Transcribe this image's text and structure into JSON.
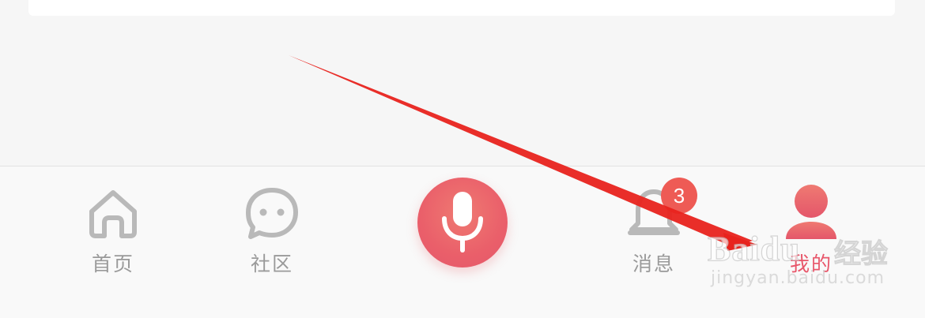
{
  "tabbar": {
    "tabs": [
      {
        "label": "首页",
        "icon": "home-icon"
      },
      {
        "label": "社区",
        "icon": "chat-bubble-icon"
      },
      {
        "label": "消息",
        "icon": "bell-icon",
        "badge": "3"
      },
      {
        "label": "我的",
        "icon": "user-icon"
      }
    ],
    "center_button": {
      "icon": "microphone-icon"
    }
  },
  "watermark": {
    "brand": "Baidu",
    "brand_cn": "经验",
    "domain": "jingyan.baidu.com"
  },
  "annotation": {
    "arrow_color": "#e8231e"
  },
  "colors": {
    "accent": "#e9606a",
    "inactive": "#b9b9b9",
    "badge": "#ee5b55"
  }
}
